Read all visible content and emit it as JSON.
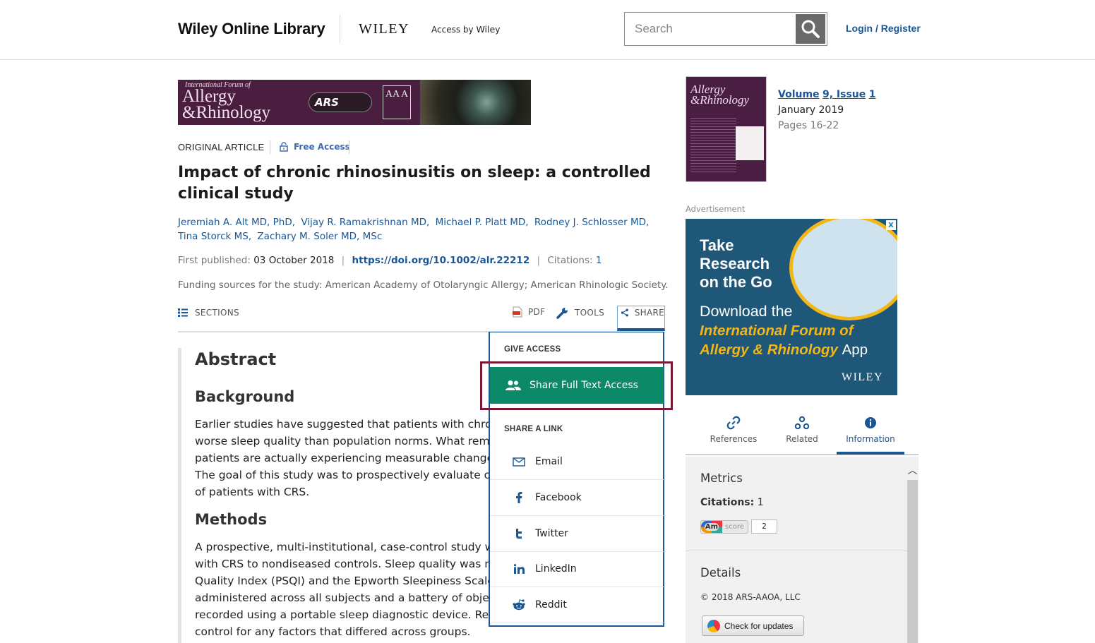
{
  "header": {
    "brand": "Wiley Online Library",
    "publisher_logo": "WILEY",
    "access_by_prefix": "Access by",
    "access_by_org": "Wiley",
    "search_placeholder": "Search",
    "login_label": "Login / Register"
  },
  "banner": {
    "small_text": "International Forum of",
    "title_line1": "Allergy",
    "title_line2": "&Rhinology",
    "ars": "ARS",
    "aaa": "AA A"
  },
  "article": {
    "type": "ORIGINAL ARTICLE",
    "free_access": "Free Access",
    "title": "Impact of chronic rhinosinusitis on sleep: a controlled clinical study",
    "authors": [
      "Jeremiah A. Alt MD, PhD,",
      "Vijay R. Ramakrishnan MD,",
      "Michael P. Platt MD,",
      "Rodney J. Schlosser MD,",
      "Tina Storck MS,",
      "Zachary M. Soler MD, MSc"
    ],
    "first_published_label": "First published:",
    "first_published_value": "03 October 2018",
    "doi": "https://doi.org/10.1002/alr.22212",
    "citations_label": "Citations:",
    "citations_value": "1",
    "funding": "Funding sources for the study: American Academy of Otolaryngic Allergy; American Rhinologic Society."
  },
  "toolbar": {
    "sections": "SECTIONS",
    "pdf": "PDF",
    "tools": "TOOLS",
    "share": "SHARE"
  },
  "abstract": {
    "heading": "Abstract",
    "background_heading": "Background",
    "background_lines": [
      "Earlier studies have suggested that patients with chronic",
      "worse sleep quality than population norms. What remai",
      "patients are actually experiencing measurable changes i",
      "The goal of this study was to prospectively evaluate obje",
      "of patients with CRS."
    ],
    "methods_heading": "Methods",
    "methods_lines": [
      "A prospective, multi-institutional, case-control study was",
      "with CRS to nondiseased controls. Sleep quality was mea",
      "Quality Index (PSQI) and the Epworth Sleepiness Scale (E",
      "administered across all subjects and a battery of objectiv",
      "recorded using a portable sleep diagnostic device. Regre",
      "control for any factors that differed across groups."
    ]
  },
  "share_menu": {
    "give_access_heading": "GIVE ACCESS",
    "share_full_text": "Share Full Text Access",
    "share_link_heading": "SHARE A LINK",
    "items": [
      {
        "label": "Email",
        "icon": "email-icon"
      },
      {
        "label": "Facebook",
        "icon": "facebook-icon"
      },
      {
        "label": "Twitter",
        "icon": "twitter-icon"
      },
      {
        "label": "LinkedIn",
        "icon": "linkedin-icon"
      },
      {
        "label": "Reddit",
        "icon": "reddit-icon"
      }
    ]
  },
  "issue": {
    "volume": "Volume",
    "volume_num": "9, Issue",
    "issue_num": "1",
    "date": "January 2019",
    "pages": "Pages 16-22",
    "cover_title_line1": "Allergy",
    "cover_title_line2": "&Rhinology"
  },
  "advert": {
    "label": "Advertisement",
    "line1": "Take",
    "line2": "Research",
    "line3": "on the Go",
    "download": "Download the",
    "journal_line1": "International Forum of",
    "journal_line2": "Allergy & Rhinology",
    "app": "App",
    "brand": "WILEY",
    "close": "x"
  },
  "tabs": {
    "references": "References",
    "related": "Related",
    "information": "Information"
  },
  "info": {
    "metrics_heading": "Metrics",
    "citations_label": "Citations:",
    "citations_value": "1",
    "altmetric_logo": "Am",
    "altmetric_label": "score",
    "altmetric_score": "2",
    "details_heading": "Details",
    "copyright": "© 2018 ARS-AAOA, LLC",
    "check_updates": "Check for updates"
  },
  "colors": {
    "link_blue": "#1a5694",
    "share_green": "#0c8a68",
    "highlight_maroon": "#7a1a32",
    "journal_purple": "#4a1e3f"
  }
}
